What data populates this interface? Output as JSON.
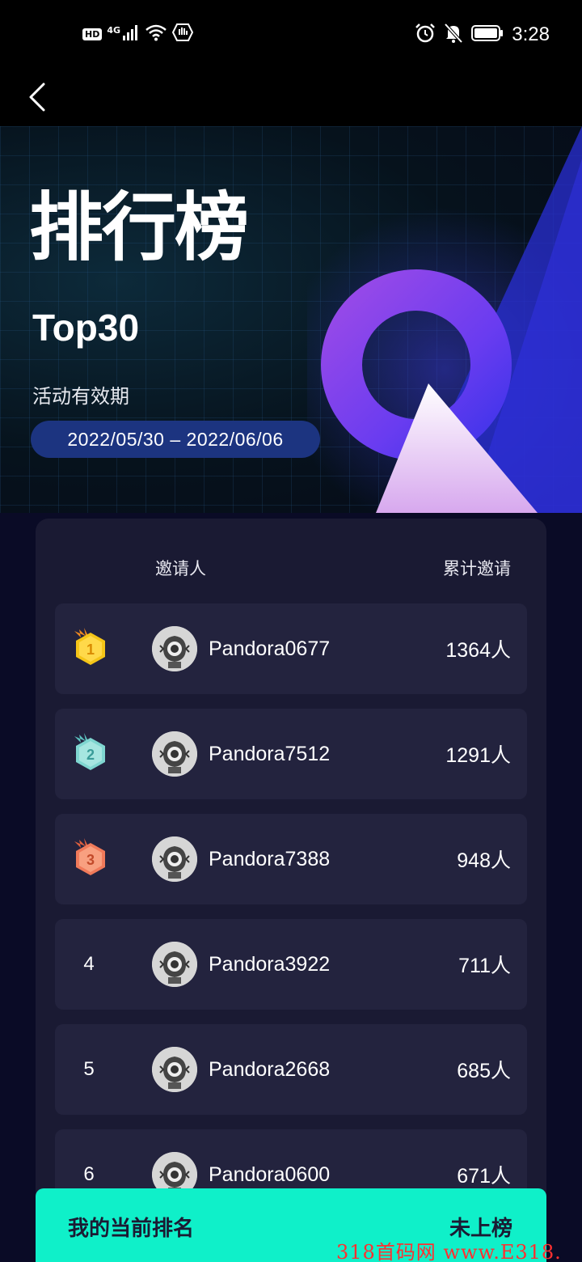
{
  "status_bar": {
    "hd": "HD",
    "network": "4G",
    "time": "3:28"
  },
  "hero": {
    "title": "排行榜",
    "subtitle": "Top30",
    "period_label": "活动有效期",
    "period_dates": "2022/05/30 – 2022/06/06"
  },
  "table": {
    "col_inviter": "邀请人",
    "col_total": "累计邀请",
    "rows": [
      {
        "rank": "1",
        "name": "Pandora0677",
        "count": "1364人",
        "badge": "gold-crown-badge",
        "badge_color": "#f5c518"
      },
      {
        "rank": "2",
        "name": "Pandora7512",
        "count": "1291人",
        "badge": "teal-crown-badge",
        "badge_color": "#7fd6d0"
      },
      {
        "rank": "3",
        "name": "Pandora7388",
        "count": "948人",
        "badge": "orange-crown-badge",
        "badge_color": "#f07a5a"
      },
      {
        "rank": "4",
        "name": "Pandora3922",
        "count": "711人"
      },
      {
        "rank": "5",
        "name": "Pandora2668",
        "count": "685人"
      },
      {
        "rank": "6",
        "name": "Pandora0600",
        "count": "671人"
      }
    ]
  },
  "my_rank": {
    "label": "我的当前排名",
    "value": "未上榜"
  },
  "watermark": "318首码网  www.E318.",
  "colors": {
    "accent": "#0ff0c9",
    "background": "#0a0b26",
    "card": "#1a1a33",
    "row": "#23233e",
    "date_pill": "#1c3480"
  }
}
